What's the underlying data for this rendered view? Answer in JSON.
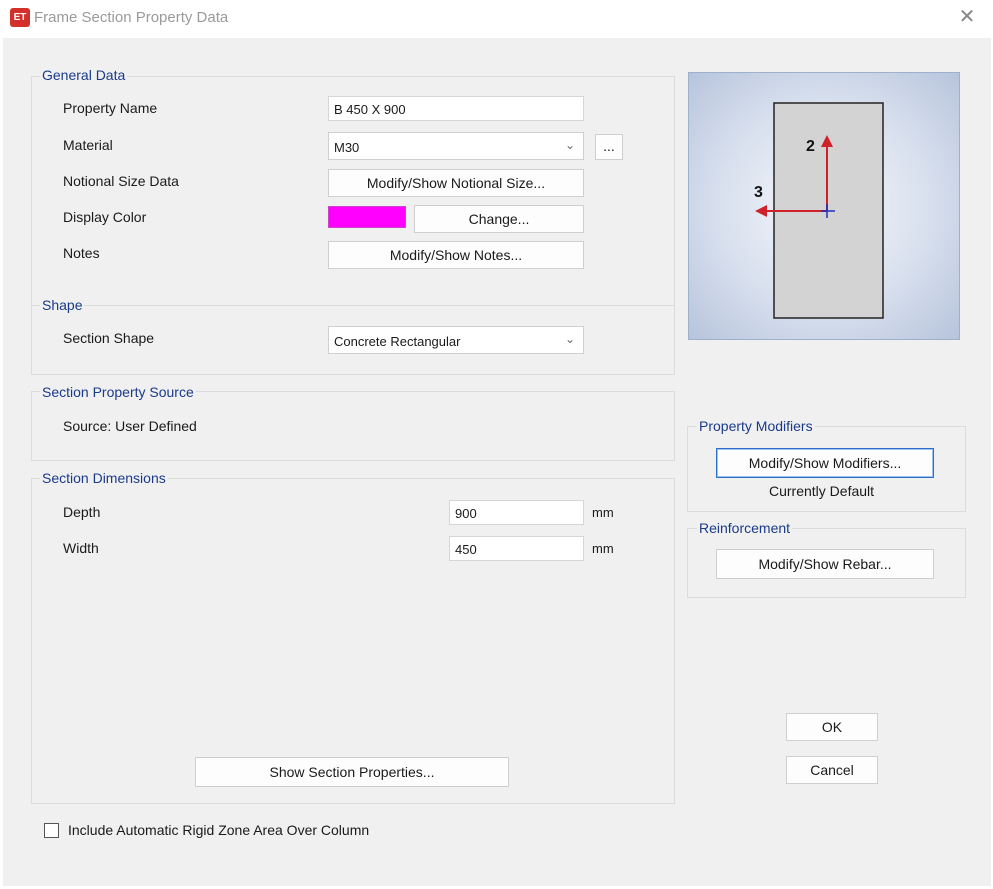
{
  "window": {
    "title": "Frame Section Property Data",
    "app_icon_text": "ET",
    "close_glyph": "✕"
  },
  "general_data": {
    "legend": "General Data",
    "property_name_label": "Property Name",
    "property_name_value": "B 450 X 900",
    "material_label": "Material",
    "material_value": "M30",
    "material_more_label": "...",
    "notional_label": "Notional Size Data",
    "notional_button": "Modify/Show Notional Size...",
    "display_color_label": "Display Color",
    "display_color_value": "#ff00ff",
    "change_button": "Change...",
    "notes_label": "Notes",
    "notes_button": "Modify/Show Notes..."
  },
  "shape": {
    "legend": "Shape",
    "section_shape_label": "Section Shape",
    "section_shape_value": "Concrete Rectangular"
  },
  "source": {
    "legend": "Section Property Source",
    "source_text": "Source:  User Defined"
  },
  "dimensions": {
    "legend": "Section Dimensions",
    "depth_label": "Depth",
    "depth_value": "900",
    "depth_unit": "mm",
    "width_label": "Width",
    "width_value": "450",
    "width_unit": "mm",
    "show_properties_button": "Show Section Properties..."
  },
  "preview": {
    "axis_2_label": "2",
    "axis_3_label": "3"
  },
  "property_modifiers": {
    "legend": "Property Modifiers",
    "button": "Modify/Show Modifiers...",
    "status": "Currently Default"
  },
  "reinforcement": {
    "legend": "Reinforcement",
    "button": "Modify/Show Rebar..."
  },
  "actions": {
    "ok": "OK",
    "cancel": "Cancel"
  },
  "rigid_zone": {
    "label": "Include Automatic Rigid Zone Area Over Column",
    "checked": false
  }
}
